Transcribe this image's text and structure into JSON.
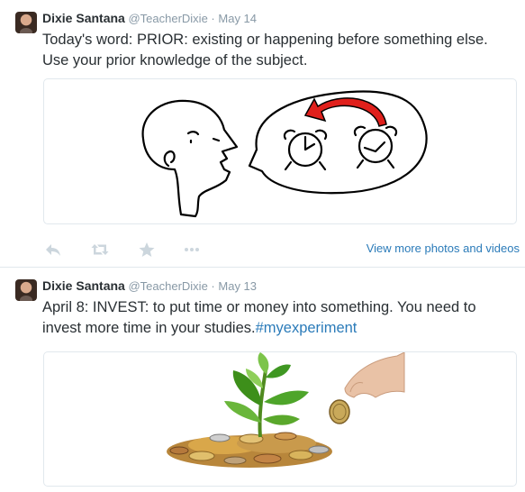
{
  "tweets": [
    {
      "name": "Dixie Santana",
      "handle": "@TeacherDixie",
      "separator": "·",
      "date": "May 14",
      "text": "Today's word: PRIOR: existing or happening before something else. Use your prior knowledge of the subject.",
      "view_more": "View more photos and videos"
    },
    {
      "name": "Dixie Santana",
      "handle": "@TeacherDixie",
      "separator": "·",
      "date": "May 13",
      "text_before_hashtag": "April 8: INVEST: to put time or money into something. You need to invest more time in your studies.",
      "hashtag": "#myexperiment"
    }
  ],
  "icons": {
    "reply": "reply-icon",
    "retweet": "retweet-icon",
    "favorite": "star-icon",
    "more": "more-icon"
  },
  "colors": {
    "link": "#2b7bb9",
    "muted": "#8899a6",
    "text": "#292f33",
    "arrow": "#e0201c"
  }
}
